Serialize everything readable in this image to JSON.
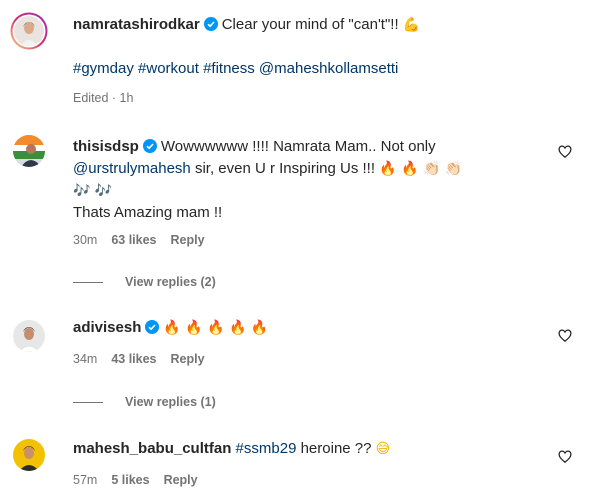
{
  "post": {
    "username": "namratashirodkar",
    "caption": "Clear your mind of \"can't\"!!",
    "caption_emoji": "💪",
    "hashtags": "#gymday #workout #fitness @maheshkollamsetti",
    "edited": "Edited · 1h"
  },
  "comments": [
    {
      "username": "thisisdsp",
      "text_1": "Wowwwwww !!!! Namrata Mam.. Not only",
      "mention": "@urstrulymahesh",
      "text_2": " sir, even U r Inspiring Us !!!",
      "emojis_1": "🔥 🔥 👏🏻 👏🏻",
      "emojis_2": "🎶 🎶",
      "text_3": "Thats Amazing mam !!",
      "time": "30m",
      "likes": "63 likes",
      "reply": "Reply",
      "view_replies": "View replies (2)"
    },
    {
      "username": "adivisesh",
      "emojis": "🔥 🔥 🔥 🔥 🔥",
      "time": "34m",
      "likes": "43 likes",
      "reply": "Reply",
      "view_replies": "View replies (1)"
    },
    {
      "username": "mahesh_babu_cultfan",
      "hashtag": "#ssmb29",
      "text": " heroine ??",
      "emoji": "😅",
      "time": "57m",
      "likes": "5 likes",
      "reply": "Reply"
    }
  ],
  "colors": {
    "text": "#262626",
    "muted": "#737373",
    "link": "#00376b",
    "verified": "#0095f6",
    "story_ring": "#d6249f"
  }
}
